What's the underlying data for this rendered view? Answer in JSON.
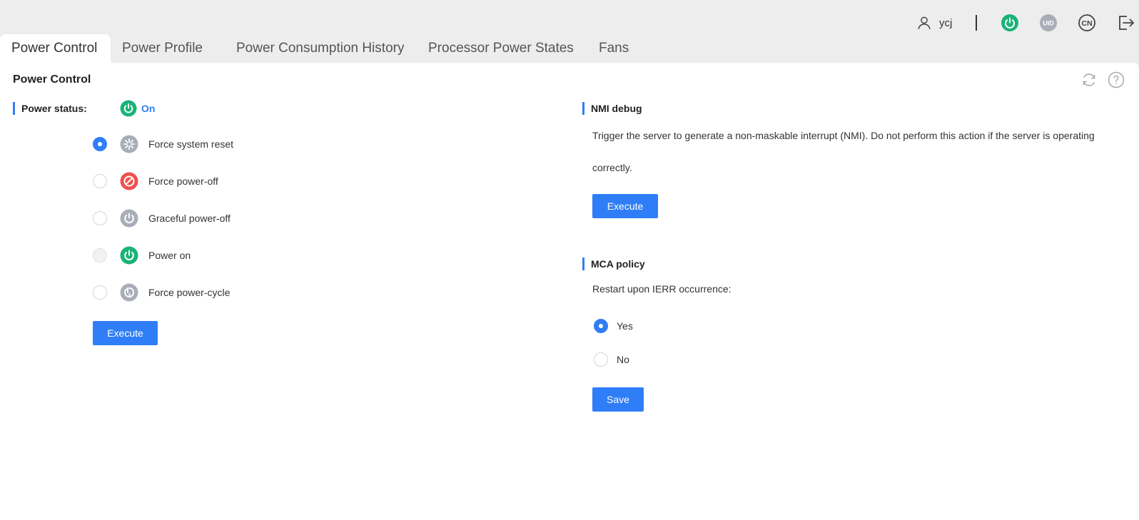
{
  "header": {
    "user_name": "ycj",
    "icons": [
      "user-icon",
      "power-status-icon",
      "uid-icon",
      "language-cn-icon",
      "logout-icon"
    ],
    "uid_text": "UID",
    "lang_text": "CN"
  },
  "tabs": [
    {
      "label": "Power Control",
      "active": true
    },
    {
      "label": "Power Profile",
      "active": false
    },
    {
      "label": "Power Consumption History",
      "active": false
    },
    {
      "label": "Processor Power States",
      "active": false
    },
    {
      "label": "Fans",
      "active": false
    }
  ],
  "page": {
    "title": "Power Control"
  },
  "power_control": {
    "status_label": "Power status:",
    "status_value": "On",
    "options": [
      {
        "label": "Force system reset",
        "checked": true,
        "disabled": false,
        "icon": "reset-icon"
      },
      {
        "label": "Force power-off",
        "checked": false,
        "disabled": false,
        "icon": "forbidden-icon"
      },
      {
        "label": "Graceful power-off",
        "checked": false,
        "disabled": false,
        "icon": "power-icon"
      },
      {
        "label": "Power on",
        "checked": false,
        "disabled": true,
        "icon": "power-on-icon"
      },
      {
        "label": "Force power-cycle",
        "checked": false,
        "disabled": false,
        "icon": "power-cycle-icon"
      }
    ],
    "execute_label": "Execute"
  },
  "nmi": {
    "title": "NMI debug",
    "description": "Trigger the server to generate a non-maskable interrupt (NMI). Do not perform this action if the server is operating correctly.",
    "execute_label": "Execute"
  },
  "mca": {
    "title": "MCA policy",
    "question": "Restart upon IERR occurrence:",
    "options": [
      {
        "label": "Yes",
        "checked": true
      },
      {
        "label": "No",
        "checked": false
      }
    ],
    "save_label": "Save"
  },
  "colors": {
    "accent": "#2f7ef7",
    "green": "#1ab378",
    "red": "#f0504f",
    "gray": "#a8adb7"
  }
}
